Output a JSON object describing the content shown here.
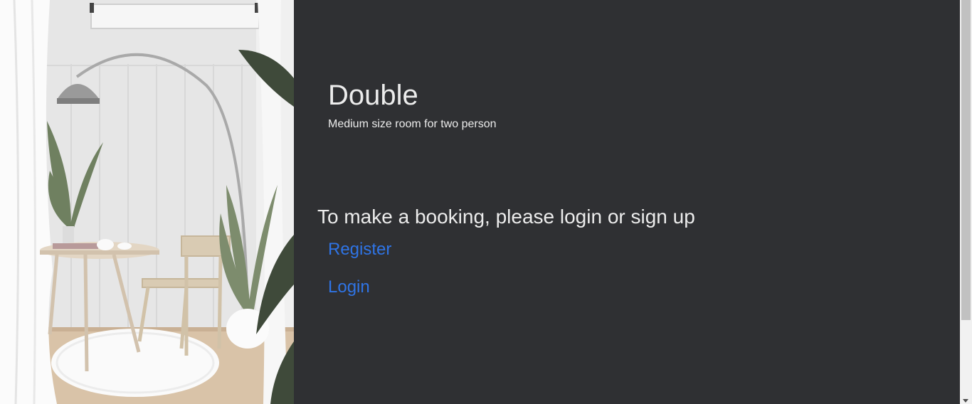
{
  "room": {
    "title": "Double",
    "description": "Medium size room for two person"
  },
  "booking": {
    "prompt": "To make a booking, please login or sign up",
    "register_label": "Register",
    "login_label": "Login"
  },
  "colors": {
    "background": "#2f3033",
    "text": "#ececec",
    "link": "#2f74e6"
  },
  "image": {
    "subject": "white interior room with arc floor lamp, round wooden table, chair and plants"
  }
}
